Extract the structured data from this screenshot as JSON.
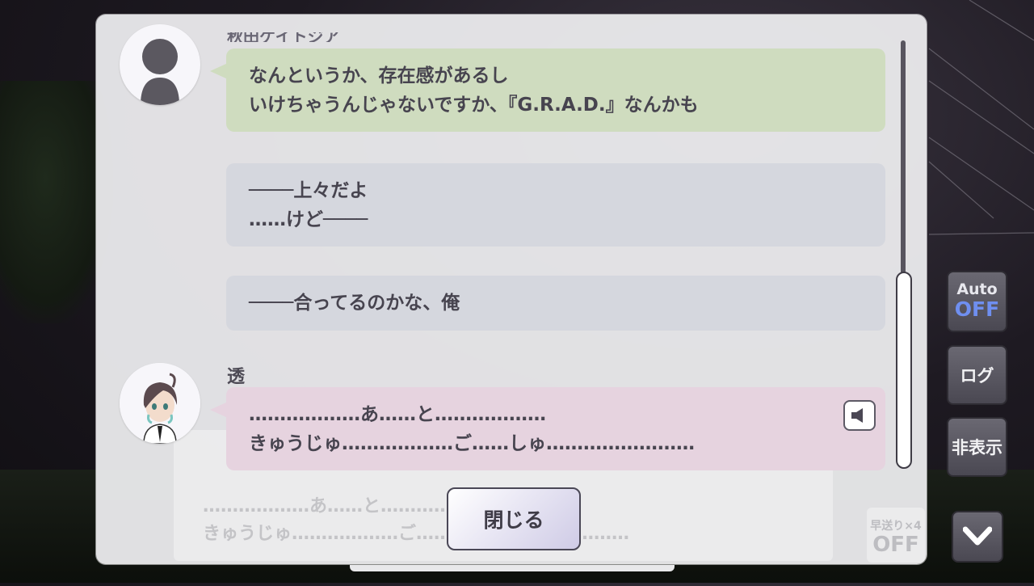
{
  "log": {
    "partial_speaker": "秋田ケイトジア",
    "entries": [
      {
        "lines": [
          "なんというか、存在感があるし",
          "いけちゃうんじゃないですか、『G.R.A.D.』なんかも"
        ]
      },
      {
        "lines": [
          "────上々だよ",
          "……けど────"
        ]
      },
      {
        "lines": [
          "────合ってるのかな、俺"
        ]
      },
      {
        "speaker": "透",
        "lines": [
          "………………あ……と………………",
          "きゅうじゅ………………ご……しゅ……………………"
        ]
      }
    ]
  },
  "background_dialog": {
    "line1": "………………あ……と………………",
    "line2": "きゅうじゅ………………ご……しゅ……………………"
  },
  "controls": {
    "close_label": "閉じる",
    "auto_label": "Auto",
    "auto_state": "OFF",
    "log_label": "ログ",
    "hide_label": "非表示",
    "speed_label": "早送り×4",
    "speed_state": "OFF"
  },
  "colors": {
    "bubble_unknown_speaker": "#cfdcbf",
    "bubble_monologue": "#d5d7de",
    "bubble_toru": "#e6d3df",
    "auto_off_text": "#6f8ff0"
  },
  "icons": [
    "silhouette-avatar-icon",
    "toru-avatar-icon",
    "speaker-voice-icon",
    "chevron-down-icon"
  ]
}
